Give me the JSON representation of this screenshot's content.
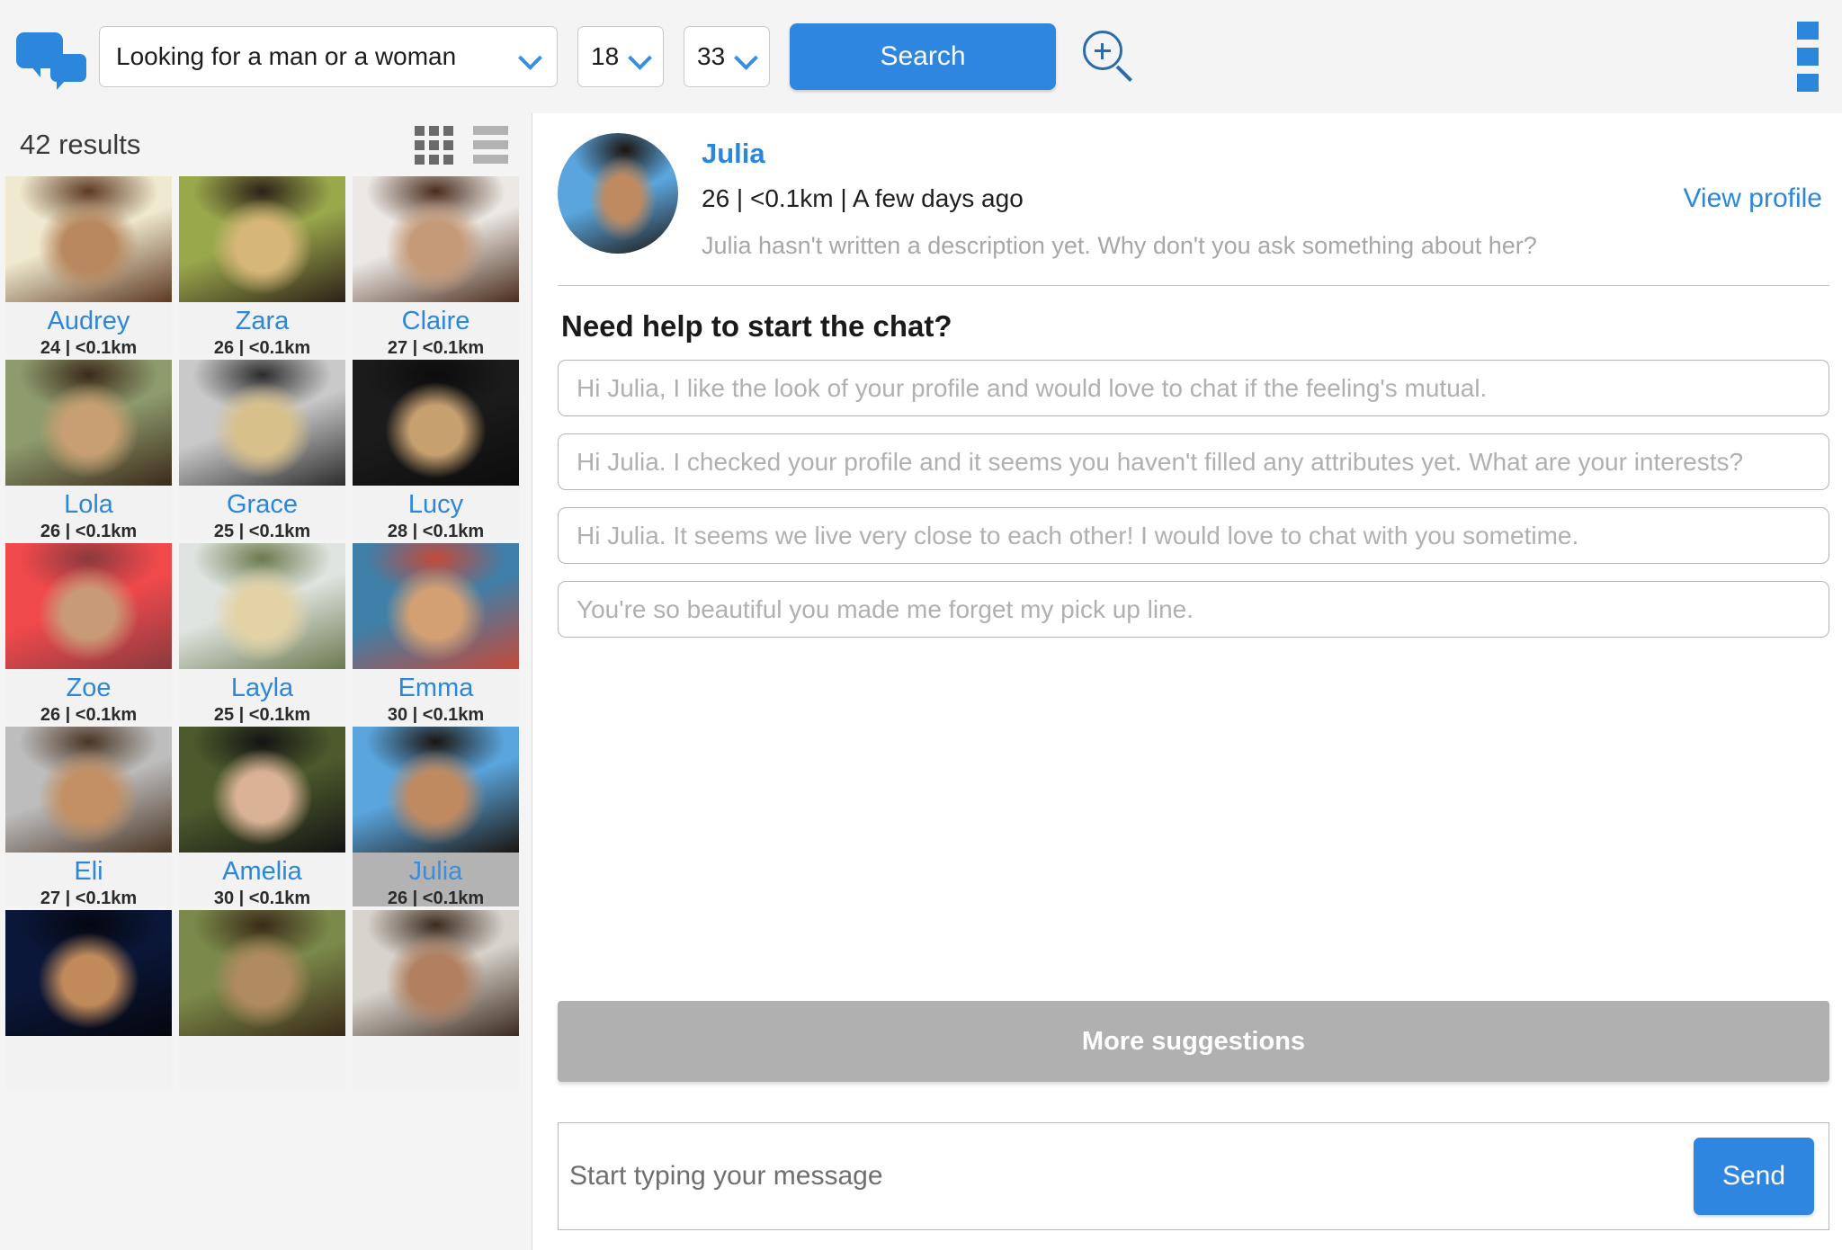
{
  "topbar": {
    "logo_icon": "chat-bubbles-icon",
    "looking_for": "Looking for a man or a woman",
    "age_min": "18",
    "age_max": "33",
    "search_label": "Search",
    "zoom_icon": "magnifier-plus-icon",
    "menu_icon": "menu-dots-icon"
  },
  "sidebar": {
    "results_text": "42 results",
    "grid_icon": "grid-view-icon",
    "list_icon": "list-view-icon",
    "cards": [
      {
        "name": "Audrey",
        "meta": "24 | <0.1km",
        "selected": false,
        "c1": "#efe9cf",
        "c2": "#b8885f",
        "c3": "#5e3a22"
      },
      {
        "name": "Zara",
        "meta": "26 | <0.1km",
        "selected": false,
        "c1": "#9aa84c",
        "c2": "#d7b67a",
        "c3": "#2d2118"
      },
      {
        "name": "Claire",
        "meta": "27 | <0.1km",
        "selected": false,
        "c1": "#ece8e4",
        "c2": "#c59a78",
        "c3": "#4a2d1c"
      },
      {
        "name": "Lola",
        "meta": "26 | <0.1km",
        "selected": false,
        "c1": "#8e9b6d",
        "c2": "#c79f72",
        "c3": "#3b2a1a"
      },
      {
        "name": "Grace",
        "meta": "25 | <0.1km",
        "selected": false,
        "c1": "#c9c9c9",
        "c2": "#d8c08a",
        "c3": "#2c2c2c"
      },
      {
        "name": "Lucy",
        "meta": "28 | <0.1km",
        "selected": false,
        "c1": "#1b1b1b",
        "c2": "#c7a070",
        "c3": "#0c0c0c"
      },
      {
        "name": "Zoe",
        "meta": "26 | <0.1km",
        "selected": false,
        "c1": "#f0494c",
        "c2": "#c99a78",
        "c3": "#8a3a3e"
      },
      {
        "name": "Layla",
        "meta": "25 | <0.1km",
        "selected": false,
        "c1": "#dfe4e0",
        "c2": "#e3d2a6",
        "c3": "#6b7a4e"
      },
      {
        "name": "Emma",
        "meta": "30 | <0.1km",
        "selected": false,
        "c1": "#3f7fa8",
        "c2": "#d3a074",
        "c3": "#c44a3a"
      },
      {
        "name": "Eli",
        "meta": "27 | <0.1km",
        "selected": false,
        "c1": "#bdbdbd",
        "c2": "#c29064",
        "c3": "#4a3524"
      },
      {
        "name": "Amelia",
        "meta": "30 | <0.1km",
        "selected": false,
        "c1": "#4c5a2c",
        "c2": "#d9b295",
        "c3": "#141414"
      },
      {
        "name": "Julia",
        "meta": "26 | <0.1km",
        "selected": true,
        "c1": "#5aa5dd",
        "c2": "#c08a60",
        "c3": "#1c1510"
      },
      {
        "name": "",
        "meta": "",
        "selected": false,
        "c1": "#0b1738",
        "c2": "#c08a5a",
        "c3": "#05070f"
      },
      {
        "name": "",
        "meta": "",
        "selected": false,
        "c1": "#7b8a4a",
        "c2": "#b08a60",
        "c3": "#3a2a18"
      },
      {
        "name": "",
        "meta": "",
        "selected": false,
        "c1": "#d8d4cd",
        "c2": "#b08060",
        "c3": "#3b2a1e"
      }
    ]
  },
  "chat": {
    "profile": {
      "name": "Julia",
      "meta": "26 | <0.1km | A few days ago",
      "view_profile_label": "View profile",
      "description": "Julia hasn't written a description yet. Why don't you ask something about her?"
    },
    "helper_title": "Need help to start the chat?",
    "suggestions": [
      "Hi Julia, I like the look of your profile and would love to chat if the feeling's mutual.",
      "Hi Julia. I checked your profile and it seems you haven't filled any attributes yet. What are your interests?",
      "Hi Julia. It seems we live very close to each other! I would love to chat with you sometime.",
      "You're so beautiful you made me forget my pick up line."
    ],
    "more_suggestions_label": "More suggestions",
    "composer_placeholder": "Start typing your message",
    "composer_value": "",
    "send_label": "Send"
  },
  "colors": {
    "accent_blue": "#2a87db",
    "button_blue": "#2f86e0",
    "muted_gray": "#b0b0b0",
    "selected_card": "#b3b3b3",
    "page_bg": "#f4f4f4"
  }
}
